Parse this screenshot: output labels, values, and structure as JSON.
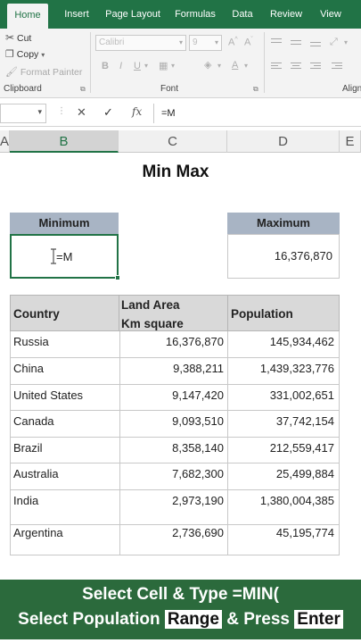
{
  "ribbon": {
    "tabs": [
      {
        "label": "Home",
        "active": true
      },
      {
        "label": "Insert"
      },
      {
        "label": "Page Layout"
      },
      {
        "label": "Formulas"
      },
      {
        "label": "Data"
      },
      {
        "label": "Review"
      },
      {
        "label": "View"
      }
    ],
    "clipboard": {
      "cut": "Cut",
      "copy": "Copy",
      "format_painter": "Format Painter",
      "group_label": "Clipboard"
    },
    "font": {
      "font_name": "Calibri",
      "font_size": "9",
      "group_label": "Font"
    },
    "alignment": {
      "group_label": "Align"
    }
  },
  "formula_bar": {
    "fx": "fx",
    "value": "=M"
  },
  "columns": [
    {
      "label": "A"
    },
    {
      "label": "B",
      "selected": true
    },
    {
      "label": "C"
    },
    {
      "label": "D"
    },
    {
      "label": "E"
    }
  ],
  "sheet": {
    "title": "Min Max",
    "minimum_header": "Minimum",
    "maximum_header": "Maximum",
    "minimum_value": "=M",
    "maximum_value": "16,376,870"
  },
  "table": {
    "headers": {
      "country": "Country",
      "land_area_line1": "Land Area",
      "land_area_line2": "Km square",
      "population": "Population"
    },
    "rows": [
      {
        "country": "Russia",
        "area": "16,376,870",
        "population": "145,934,462"
      },
      {
        "country": "China",
        "area": "9,388,211",
        "population": "1,439,323,776"
      },
      {
        "country": "United States",
        "area": "9,147,420",
        "population": "331,002,651"
      },
      {
        "country": "Canada",
        "area": "9,093,510",
        "population": "37,742,154"
      },
      {
        "country": "Brazil",
        "area": "8,358,140",
        "population": "212,559,417"
      },
      {
        "country": "Australia",
        "area": "7,682,300",
        "population": "25,499,884"
      },
      {
        "country": "India",
        "area": "2,973,190",
        "population": "1,380,004,385"
      },
      {
        "country": "Argentina",
        "area": "2,736,690",
        "population": "45,195,774"
      }
    ]
  },
  "caption": {
    "line1": "Select Cell & Type =MIN(",
    "line2_a": "Select Population",
    "line2_b": "Range",
    "line2_c": "& Press",
    "line2_d": "Enter"
  },
  "colors": {
    "excel_green": "#217346",
    "header_blue_gray": "#a8b4c4",
    "caption_green": "#2b6a3c"
  }
}
